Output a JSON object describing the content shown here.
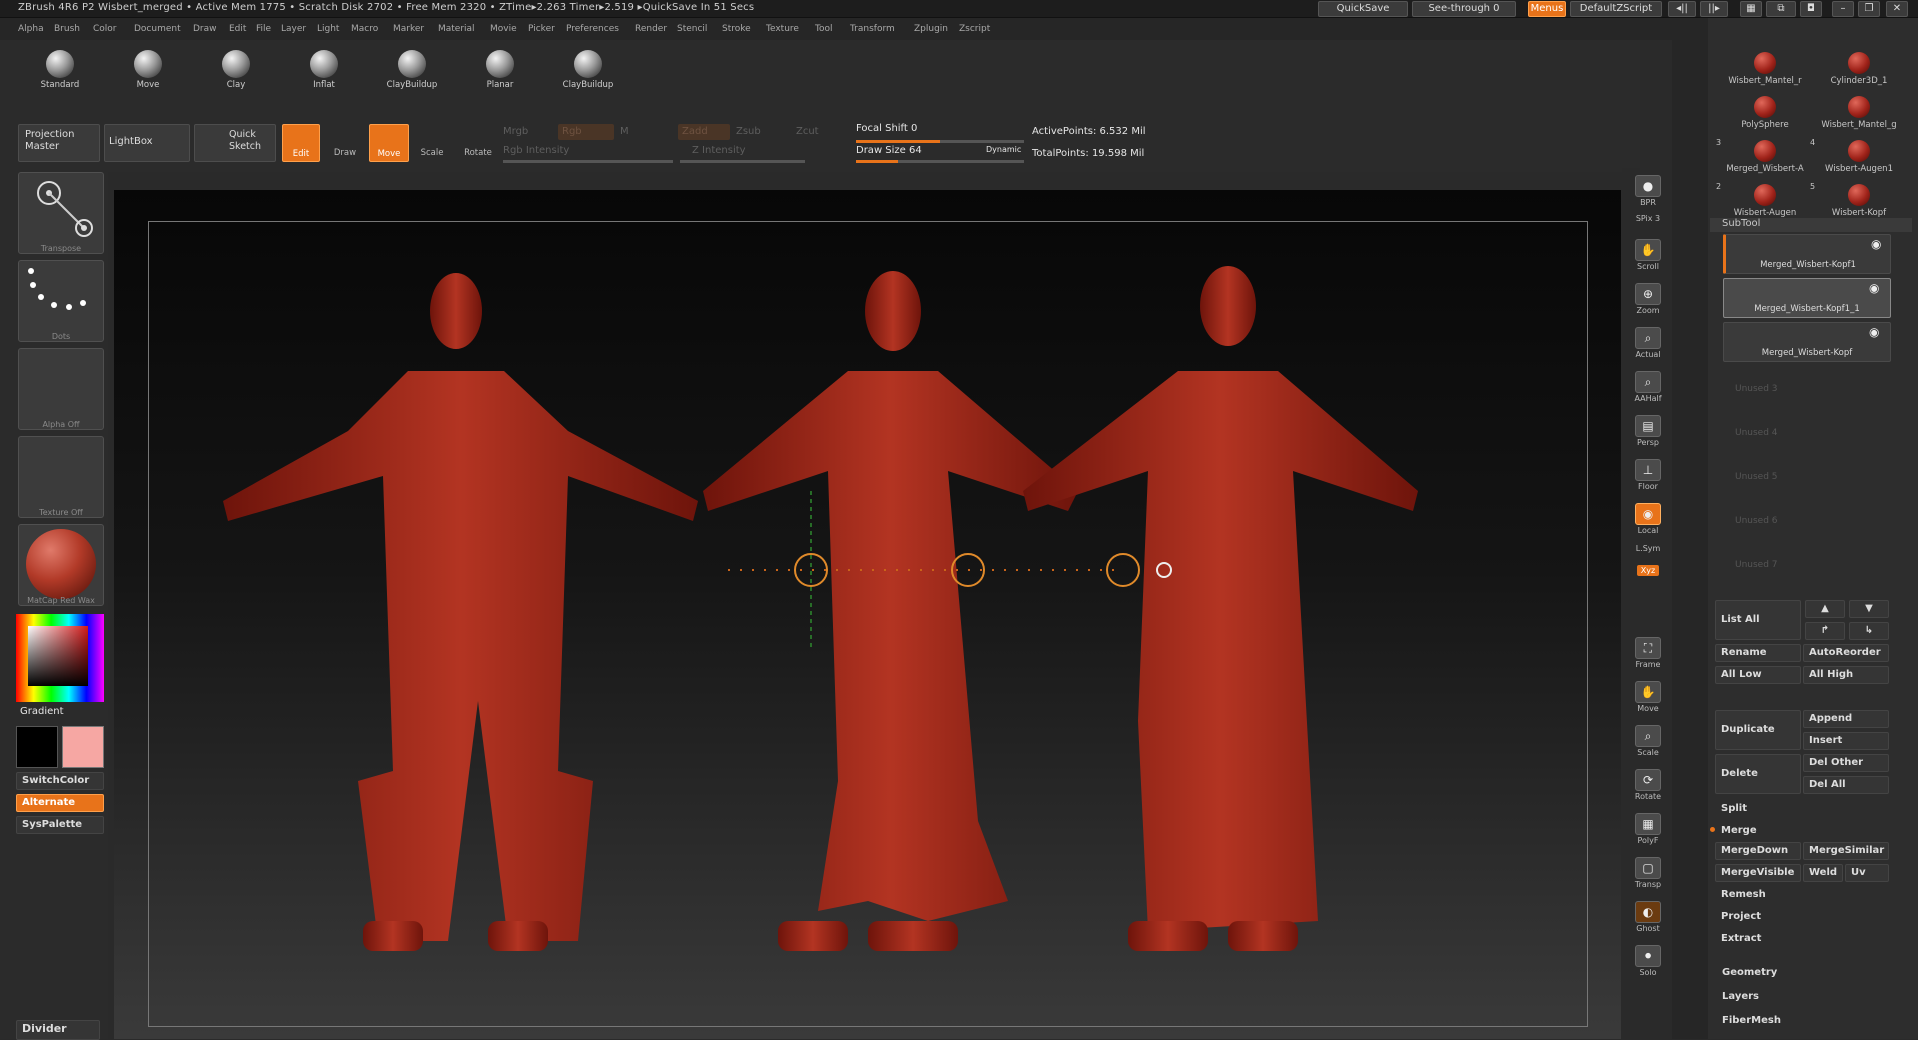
{
  "titlebar": {
    "text": "ZBrush 4R6 P2    Wisbert_merged    • Active Mem 1775 • Scratch Disk 2702 • Free Mem 2320 • ZTime▸2.263 Timer▸2.519 ▸QuickSave In 51 Secs",
    "quicksave": "QuickSave",
    "seethrough": "See-through  0",
    "menus": "Menus",
    "defaultzscript": "DefaultZScript"
  },
  "menubar": [
    "Alpha",
    "Brush",
    "Color",
    "Document",
    "Draw",
    "Edit",
    "File",
    "Layer",
    "Light",
    "Macro",
    "Marker",
    "Material",
    "Movie",
    "Picker",
    "Preferences",
    "Render",
    "Stencil",
    "Stroke",
    "Texture",
    "Tool",
    "Transform",
    "Zplugin",
    "Zscript"
  ],
  "brushes": [
    "Standard",
    "Move",
    "Clay",
    "Inflat",
    "ClayBuildup",
    "Planar",
    "ClayBuildup"
  ],
  "toolrow": {
    "projection": "Projection\nMaster",
    "lightbox": "LightBox",
    "quicksketch": "Quick\nSketch",
    "edit": "Edit",
    "draw": "Draw",
    "move": "Move",
    "scale": "Scale",
    "rotate": "Rotate",
    "mrgb": "Mrgb",
    "rgb": "Rgb",
    "m": "M",
    "rgb_intensity": "Rgb  Intensity",
    "zadd": "Zadd",
    "zsub": "Zsub",
    "zcut": "Zcut",
    "z_intensity": "Z  Intensity",
    "focal_shift": "Focal  Shift  0",
    "draw_size": "Draw  Size  64",
    "dynamic": "Dynamic",
    "active_points": "ActivePoints: 6.532  Mil",
    "total_points": "TotalPoints: 19.598  Mil"
  },
  "leftpanel": {
    "transpose": "Transpose",
    "dots": "Dots",
    "alpha": "Alpha  Off",
    "texture": "Texture  Off",
    "matcap": "MatCap  Red  Wax",
    "gradient": "Gradient",
    "switchcolor": "SwitchColor",
    "alternate": "Alternate",
    "syspalette": "SysPalette",
    "divider": "Divider"
  },
  "rightshelf": [
    "BPR",
    "SPix 3",
    "Scroll",
    "Zoom",
    "Actual",
    "AAHalf",
    "Persp",
    "Floor",
    "Local",
    "L.Sym",
    "Xyz",
    "Frame",
    "Move",
    "Scale",
    "Rotate",
    "PolyF",
    "Transp",
    "Ghost",
    "Solo"
  ],
  "tools": [
    {
      "label": "Wisbert_Mantel_r"
    },
    {
      "label": "Cylinder3D_1"
    },
    {
      "label": "PolySphere"
    },
    {
      "label": "Wisbert_Mantel_g"
    },
    {
      "label": "Merged_Wisbert-A",
      "num": "3"
    },
    {
      "label": "Wisbert-Augen1",
      "num": "4"
    },
    {
      "label": "Wisbert-Augen",
      "num": "2"
    },
    {
      "label": "Wisbert-Kopf",
      "num": "5"
    }
  ],
  "subtool": {
    "header": "SubTool",
    "items": [
      "Merged_Wisbert-Kopf1",
      "Merged_Wisbert-Kopf1_1",
      "Merged_Wisbert-Kopf"
    ],
    "unused": [
      "Unused  3",
      "Unused  4",
      "Unused  5",
      "Unused  6",
      "Unused  7"
    ]
  },
  "subtool_buttons": {
    "list_all": "List  All",
    "rename": "Rename",
    "autoreorder": "AutoReorder",
    "all_low": "All  Low",
    "all_high": "All  High",
    "duplicate": "Duplicate",
    "append": "Append",
    "insert": "Insert",
    "delete": "Delete",
    "del_other": "Del  Other",
    "del_all": "Del  All",
    "split": "Split",
    "merge": "Merge",
    "mergedown": "MergeDown",
    "mergesimilar": "MergeSimilar",
    "mergevisible": "MergeVisible",
    "weld": "Weld",
    "uv": "Uv",
    "remesh": "Remesh",
    "project": "Project",
    "extract": "Extract",
    "geometry": "Geometry",
    "layers": "Layers",
    "fibermesh": "FiberMesh"
  }
}
